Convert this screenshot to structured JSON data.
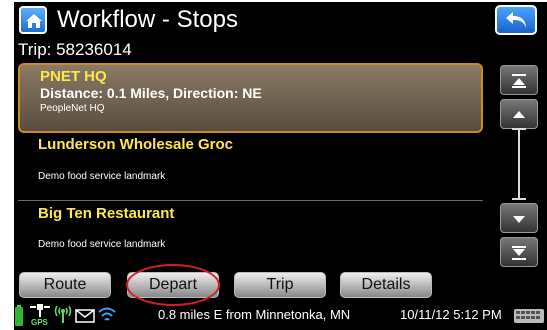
{
  "header": {
    "title": "Workflow - Stops",
    "trip_label": "Trip: 58236014"
  },
  "stops": [
    {
      "name": "PNET HQ",
      "distance": "Distance: 0.1 Miles, Direction: NE",
      "description": "PeopleNet HQ",
      "selected": true
    },
    {
      "name": "Lunderson Wholesale Groc",
      "description": "Demo food service landmark",
      "selected": false
    },
    {
      "name": "Big Ten Restaurant",
      "description": "Demo food service landmark",
      "selected": false
    }
  ],
  "scroll": {
    "buttons": [
      "scroll-top",
      "scroll-up",
      "scroll-down",
      "scroll-bottom"
    ]
  },
  "tabs": {
    "route": "Route",
    "depart": "Depart",
    "trip": "Trip",
    "details": "Details"
  },
  "status": {
    "gps_label": "GPS",
    "location": "0.8 miles E from Minnetonka, MN",
    "datetime": "10/11/12 5:12 PM",
    "icons": [
      "battery-icon",
      "gps-icon",
      "signal-icon",
      "mail-icon",
      "wifi-icon",
      "keyboard-icon"
    ]
  },
  "colors": {
    "stop_name": "#ffe84a",
    "selected_border": "#c88a2a",
    "annotation_circle": "#d21e2a",
    "button_blue": "#1f6fd0"
  }
}
